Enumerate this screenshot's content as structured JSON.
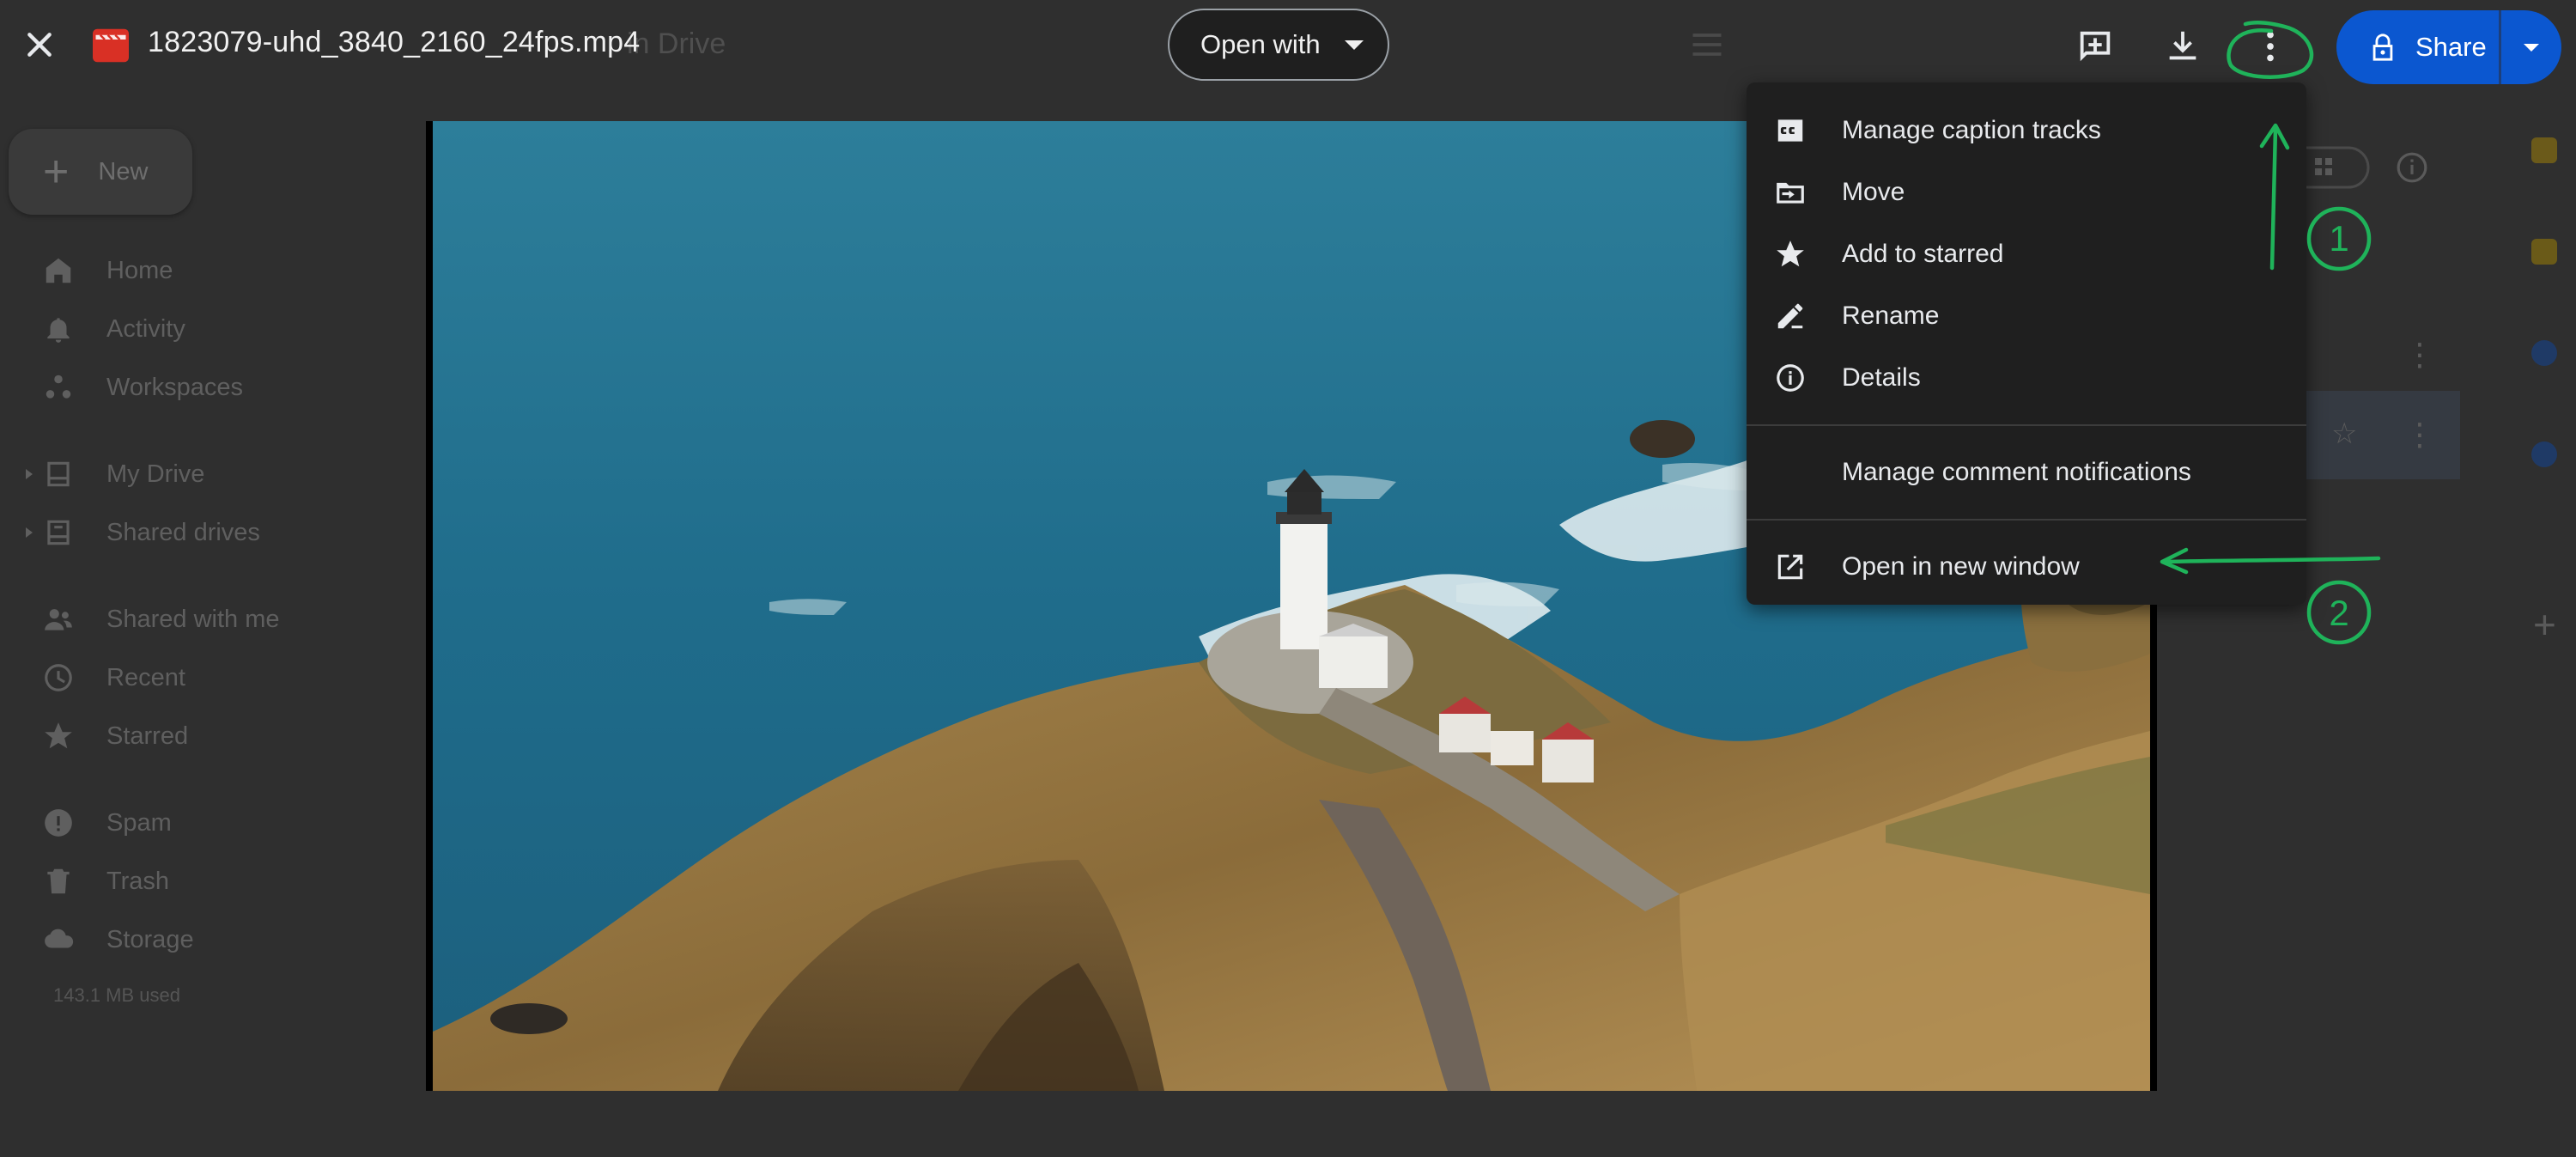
{
  "header": {
    "file_name": "1823079-uhd_3840_2160_24fps.mp4",
    "open_with_label": "Open with",
    "share_label": "Share",
    "ghost_location": "in Drive"
  },
  "sidebar": {
    "new_label": "New",
    "items": [
      {
        "label": "Home",
        "icon": "home-icon"
      },
      {
        "label": "Activity",
        "icon": "bell-icon"
      },
      {
        "label": "Workspaces",
        "icon": "workspaces-icon"
      },
      {
        "label": "My Drive",
        "icon": "drive-icon"
      },
      {
        "label": "Shared drives",
        "icon": "shared-drives-icon"
      },
      {
        "label": "Shared with me",
        "icon": "people-icon"
      },
      {
        "label": "Recent",
        "icon": "clock-icon"
      },
      {
        "label": "Starred",
        "icon": "star-icon"
      },
      {
        "label": "Spam",
        "icon": "spam-icon"
      },
      {
        "label": "Trash",
        "icon": "trash-icon"
      },
      {
        "label": "Storage",
        "icon": "cloud-icon"
      }
    ],
    "storage_used": "143.1 MB used"
  },
  "menu": {
    "items": [
      {
        "label": "Manage caption tracks",
        "icon": "cc-icon"
      },
      {
        "label": "Move",
        "icon": "move-icon"
      },
      {
        "label": "Add to starred",
        "icon": "star-icon"
      },
      {
        "label": "Rename",
        "icon": "pencil-icon"
      },
      {
        "label": "Details",
        "icon": "info-icon"
      },
      {
        "label": "Manage comment notifications",
        "icon": ""
      },
      {
        "label": "Open in new window",
        "icon": "open-in-new-icon"
      }
    ]
  },
  "annotations": {
    "step1": "1",
    "step2": "2",
    "color": "#1fb35a"
  },
  "colors": {
    "share_bg": "#0b57d0",
    "menu_bg": "#1f1f1f",
    "page_bg": "#2f2f2f"
  }
}
